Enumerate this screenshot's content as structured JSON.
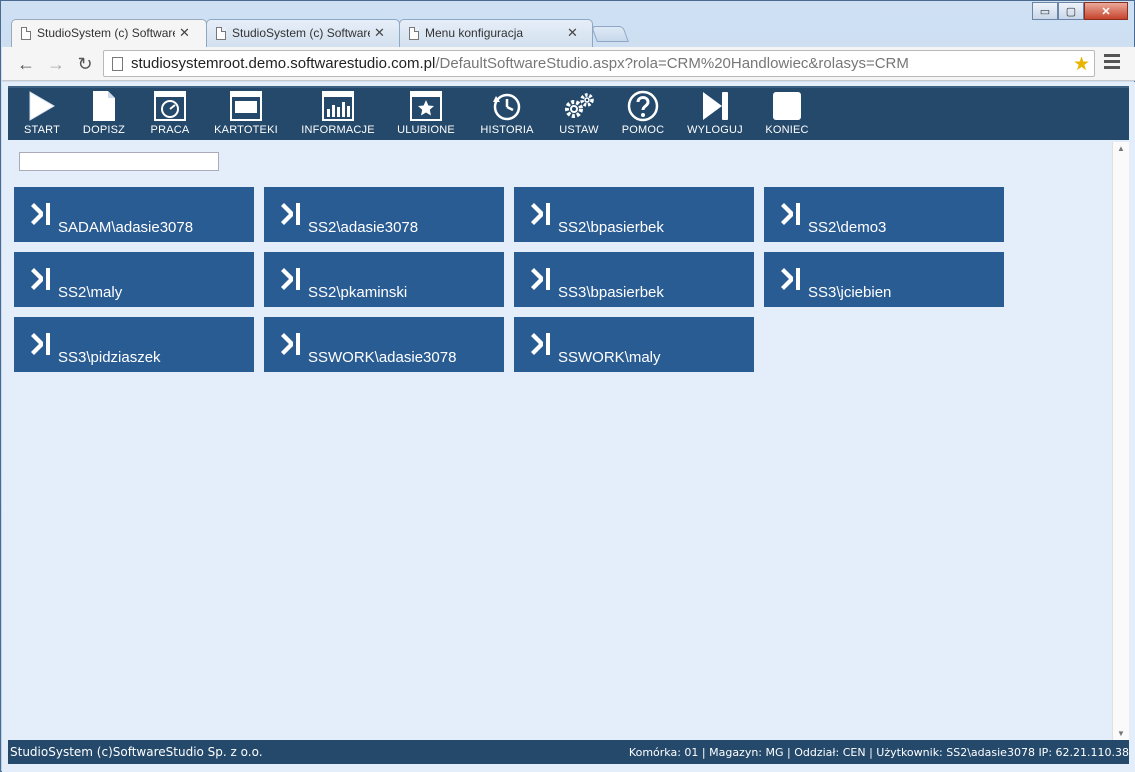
{
  "browser": {
    "tabs": [
      {
        "title": "StudioSystem (c) Software",
        "active": true
      },
      {
        "title": "StudioSystem (c) Software",
        "active": false
      },
      {
        "title": "Menu konfiguracja",
        "active": false
      }
    ],
    "close_glyph": "✕",
    "window_buttons": {
      "minimize": "▭",
      "maximize": "▢",
      "close": "✕"
    },
    "url_host": "studiosystemroot.demo.softwarestudio.com.pl",
    "url_path": "/DefaultSoftwareStudio.aspx?rola=CRM%20Handlowiec&rolasys=CRM",
    "back": "←",
    "forward": "→",
    "reload": "↻",
    "star": "★"
  },
  "app_toolbar": [
    {
      "label": "START",
      "icon": "play-icon"
    },
    {
      "label": "DOPISZ",
      "icon": "document-icon"
    },
    {
      "label": "PRACA",
      "icon": "dashboard-icon"
    },
    {
      "label": "KARTOTEKI",
      "icon": "window-icon"
    },
    {
      "label": "INFORMACJE",
      "icon": "bar-chart-icon"
    },
    {
      "label": "ULUBIONE",
      "icon": "star-window-icon"
    },
    {
      "label": "HISTORIA",
      "icon": "history-icon"
    },
    {
      "label": "USTAW",
      "icon": "gears-icon"
    },
    {
      "label": "POMOC",
      "icon": "help-icon"
    },
    {
      "label": "WYLOGUJ",
      "icon": "logout-icon"
    },
    {
      "label": "KONIEC",
      "icon": "stop-icon"
    }
  ],
  "search": {
    "value": "",
    "placeholder": ""
  },
  "tiles": [
    "SADAM\\adasie3078",
    "SS2\\adasie3078",
    "SS2\\bpasierbek",
    "SS2\\demo3",
    "SS2\\maly",
    "SS2\\pkaminski",
    "SS3\\bpasierbek",
    "SS3\\jciebien",
    "SS3\\pidziaszek",
    "SSWORK\\adasie3078",
    "SSWORK\\maly"
  ],
  "status": {
    "left": "StudioSystem (c)SoftwareStudio Sp. z o.o.",
    "right": "Komórka: 01 | Magazyn: MG | Oddział: CEN | Użytkownik: SS2\\adasie3078 IP: 62.21.110.38"
  },
  "colors": {
    "toolbar_bg": "#24496b",
    "tile_bg": "#2a5c94",
    "app_bg": "#e4eefa"
  }
}
